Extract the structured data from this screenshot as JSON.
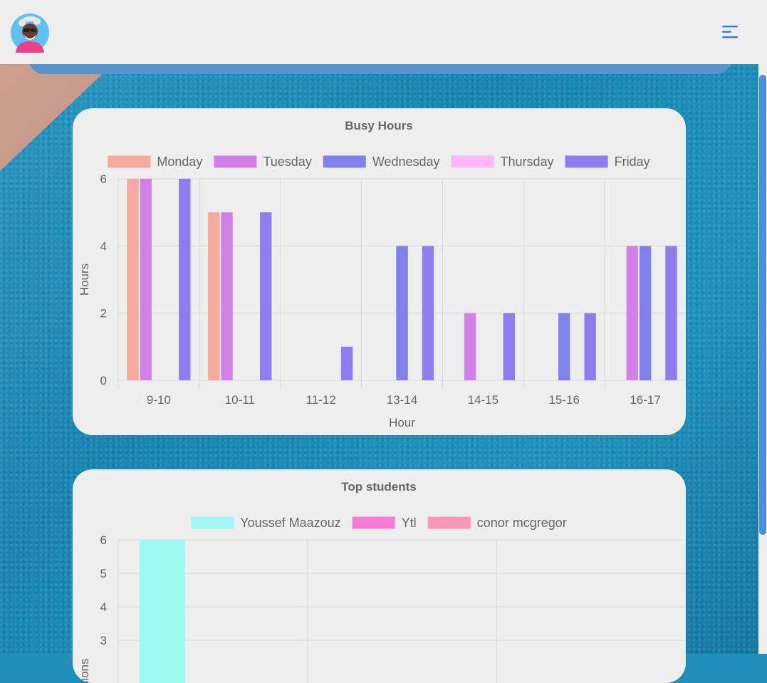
{
  "header": {
    "avatar_icon": "avatar-icon",
    "menu_icon": "menu-icon"
  },
  "colors": {
    "header_bg": "#eeeeee",
    "accent_blue": "#2b7fd4",
    "card_bg": "#eeeeee"
  },
  "chart_data": [
    {
      "type": "bar",
      "title": "Busy Hours",
      "xlabel": "Hour",
      "ylabel": "Hours",
      "categories": [
        "9-10",
        "10-11",
        "11-12",
        "13-14",
        "14-15",
        "15-16",
        "16-17"
      ],
      "ylim": [
        0,
        6
      ],
      "yticks": [
        0,
        2,
        4,
        6
      ],
      "grid": true,
      "legend_position": "top",
      "series": [
        {
          "name": "Monday",
          "color": "#f5a99a",
          "values": [
            6,
            5,
            0,
            0,
            0,
            0,
            0
          ]
        },
        {
          "name": "Tuesday",
          "color": "#d27fe8",
          "values": [
            6,
            5,
            0,
            0,
            2,
            0,
            4
          ]
        },
        {
          "name": "Wednesday",
          "color": "#7f80ec",
          "values": [
            0,
            0,
            0,
            4,
            0,
            2,
            4
          ]
        },
        {
          "name": "Thursday",
          "color": "#fbb7f8",
          "values": [
            0,
            0,
            0,
            0,
            0,
            0,
            0
          ]
        },
        {
          "name": "Friday",
          "color": "#8f7cf0",
          "values": [
            6,
            5,
            1,
            4,
            2,
            2,
            4
          ]
        }
      ]
    },
    {
      "type": "bar",
      "title": "Top students",
      "ylabel": "Sessions",
      "ylim": [
        0,
        6
      ],
      "yticks": [
        3,
        4,
        5,
        6
      ],
      "grid": true,
      "legend_position": "top",
      "series": [
        {
          "name": "Youssef Maazouz",
          "color": "#9ef9f3",
          "values": [
            6
          ]
        },
        {
          "name": "Ytl",
          "color": "#fb7ad8",
          "values": [
            null
          ]
        },
        {
          "name": "conor mcgregor",
          "color": "#fc97b8",
          "values": [
            null
          ]
        }
      ]
    }
  ]
}
